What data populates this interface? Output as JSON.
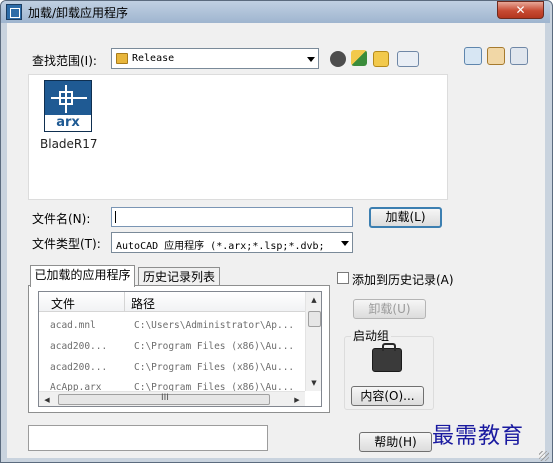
{
  "window": {
    "title": "加载/卸载应用程序",
    "close_glyph": "✕"
  },
  "lookin": {
    "label": "查找范围(I):",
    "value": "Release"
  },
  "file_pane": {
    "items": [
      {
        "name": "BladeR17",
        "icon": "arx-file-icon",
        "icon_text": "arx"
      }
    ]
  },
  "filename": {
    "label": "文件名(N):",
    "value": ""
  },
  "filetype": {
    "label": "文件类型(T):",
    "value": "AutoCAD 应用程序 (*.arx;*.lsp;*.dvb;"
  },
  "buttons": {
    "load": "加载(L)",
    "unload": "卸载(U)",
    "contents": "内容(O)...",
    "help": "帮助(H)"
  },
  "tabs": [
    {
      "label": "已加载的应用程序",
      "active": true
    },
    {
      "label": "历史记录列表",
      "active": false
    }
  ],
  "list": {
    "columns": [
      "文件",
      "路径"
    ],
    "rows": [
      {
        "file": "acad.mnl",
        "path": "C:\\Users\\Administrator\\Ap..."
      },
      {
        "file": "acad200...",
        "path": "C:\\Program Files (x86)\\Au..."
      },
      {
        "file": "acad200...",
        "path": "C:\\Program Files (x86)\\Au..."
      },
      {
        "file": "AcApp.arx",
        "path": "C:\\Program Files (x86)\\Au..."
      }
    ],
    "grip_glyph": "III"
  },
  "history": {
    "checkbox_label": "添加到历史记录(A)",
    "checked": false
  },
  "startup": {
    "label": "启动组"
  },
  "watermark": "最需教育",
  "colors": {
    "title_bar": "#a9bdd4",
    "close_button": "#c74a32",
    "dialog_bg": "#f0f0f0",
    "watermark": "#1a1aa0"
  }
}
